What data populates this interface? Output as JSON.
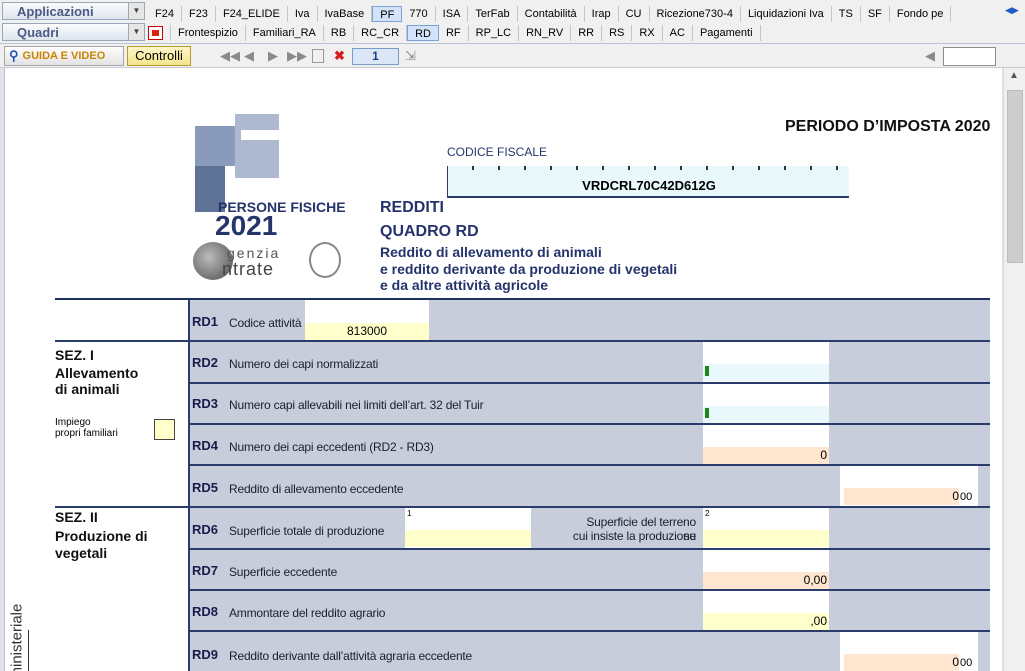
{
  "app": {
    "applicazioni_label": "Applicazioni",
    "quadri_label": "Quadri",
    "app_tabs": [
      "F24",
      "F23",
      "F24_ELIDE",
      "Iva",
      "IvaBase",
      "PF",
      "770",
      "ISA",
      "TerFab",
      "Contabilità",
      "Irap",
      "CU",
      "Ricezione730-4",
      "Liquidazioni Iva",
      "TS",
      "SF",
      "Fondo pe"
    ],
    "active_app_tab": "PF",
    "quadri_tabs": [
      "Frontespizio",
      "Familiari_RA",
      "RB",
      "RC_CR",
      "RD",
      "RF",
      "RP_LC",
      "RN_RV",
      "RR",
      "RS",
      "RX",
      "AC",
      "Pagamenti"
    ],
    "active_quadro_tab": "RD"
  },
  "toolbar": {
    "guida_label": "GUIDA E VIDEO",
    "controlli_label": "Controlli",
    "page_number": "1",
    "goto_value": ""
  },
  "form": {
    "logo_pf": "PF",
    "logo_persone": "PERSONE FISICHE",
    "logo_year": "2021",
    "agenzia_line1": "genzia",
    "agenzia_line2": "ntrate",
    "periodo": "PERIODO D’IMPOSTA 2020",
    "cf_label": "CODICE FISCALE",
    "cf_value": "VRDCRL70C42D612G",
    "redditi": "REDDITI",
    "quadro": "QUADRO RD",
    "subtitle1": "Reddito di allevamento di animali",
    "subtitle2": "e reddito derivante da produzione di vegetali",
    "subtitle3": "e da altre attività agricole",
    "sez1_title1": "SEZ. I",
    "sez1_title2": "Allevamento",
    "sez1_title3": "di animali",
    "impiego1": "Impiego",
    "impiego2": "propri familiari",
    "sez2_title1": "SEZ. II",
    "sez2_title2": "Produzione di",
    "sez2_title3": "vegetali",
    "side_label": "ministeriale",
    "rows": {
      "rd1": {
        "code": "RD1",
        "desc": "Codice attività",
        "value": "813000"
      },
      "rd2": {
        "code": "RD2",
        "desc": "Numero dei capi normalizzati",
        "value": ""
      },
      "rd3": {
        "code": "RD3",
        "desc": "Numero capi allevabili nei limiti dell’art. 32 del Tuir",
        "value": ""
      },
      "rd4": {
        "code": "RD4",
        "desc": "Numero dei capi eccedenti (RD2 - RD3)",
        "value": "0"
      },
      "rd5": {
        "code": "RD5",
        "desc": "Reddito di allevamento eccedente",
        "value": "0",
        "cents": "00"
      },
      "rd6": {
        "code": "RD6",
        "desc": "Superficie totale di produzione",
        "col1": "1",
        "col2": "2",
        "label2a": "Superficie del terreno su",
        "label2b": "cui insiste la produzione",
        "value1": "",
        "value2": ""
      },
      "rd7": {
        "code": "RD7",
        "desc": "Superficie eccedente",
        "value": "0,00"
      },
      "rd8": {
        "code": "RD8",
        "desc": "Ammontare del reddito agrario",
        "value": ",00"
      },
      "rd9": {
        "code": "RD9",
        "desc": "Reddito derivante dall’attività agraria eccedente",
        "value": "0",
        "cents": "00"
      }
    }
  }
}
